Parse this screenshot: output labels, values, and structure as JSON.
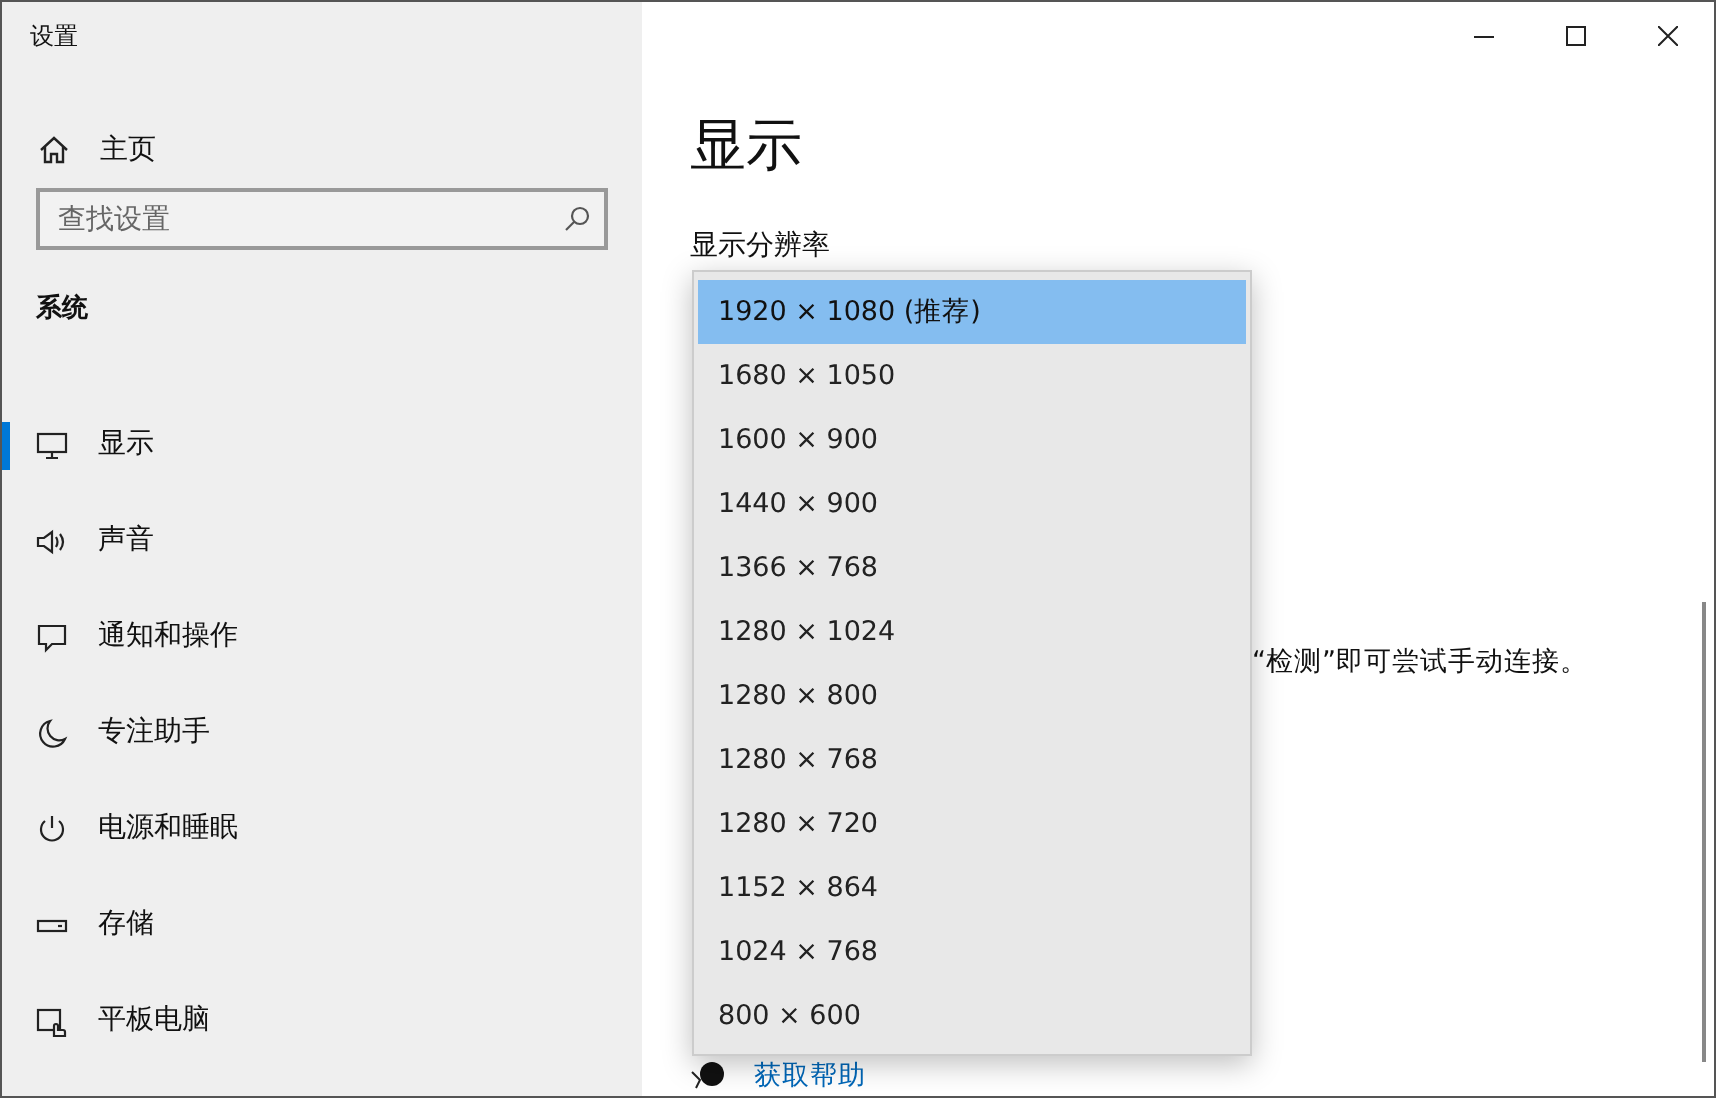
{
  "window": {
    "title": "设置"
  },
  "sidebar": {
    "home": "主页",
    "search": {
      "placeholder": "查找设置"
    },
    "section": "系统",
    "items": [
      {
        "label": "显示",
        "kind": "monitor",
        "selected": true
      },
      {
        "label": "声音",
        "kind": "speaker",
        "selected": false
      },
      {
        "label": "通知和操作",
        "kind": "message",
        "selected": false
      },
      {
        "label": "专注助手",
        "kind": "moon",
        "selected": false
      },
      {
        "label": "电源和睡眠",
        "kind": "power",
        "selected": false
      },
      {
        "label": "存储",
        "kind": "drive",
        "selected": false
      },
      {
        "label": "平板电脑",
        "kind": "tablet",
        "selected": false
      }
    ]
  },
  "main": {
    "title": "显示",
    "resolution_label": "显示分辨率",
    "partial_text": "“检测”即可尝试手动连接。",
    "help_link": "获取帮助"
  },
  "resolution_menu": [
    {
      "label": "1920 × 1080 (推荐)",
      "selected": true
    },
    {
      "label": "1680 × 1050",
      "selected": false
    },
    {
      "label": "1600 × 900",
      "selected": false
    },
    {
      "label": "1440 × 900",
      "selected": false
    },
    {
      "label": "1366 × 768",
      "selected": false
    },
    {
      "label": "1280 × 1024",
      "selected": false
    },
    {
      "label": "1280 × 800",
      "selected": false
    },
    {
      "label": "1280 × 768",
      "selected": false
    },
    {
      "label": "1280 × 720",
      "selected": false
    },
    {
      "label": "1152 × 864",
      "selected": false
    },
    {
      "label": "1024 × 768",
      "selected": false
    },
    {
      "label": "800 × 600",
      "selected": false
    }
  ]
}
